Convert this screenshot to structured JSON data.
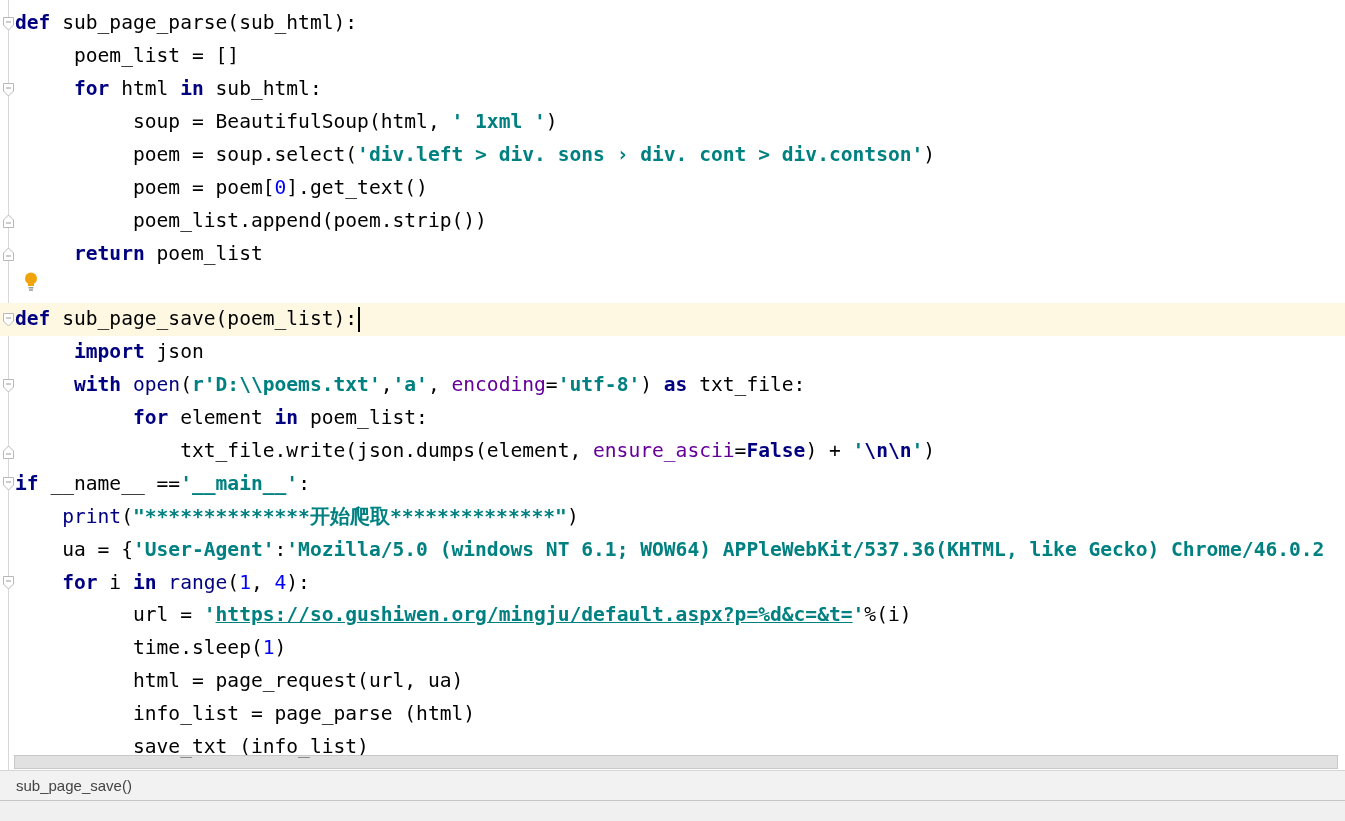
{
  "editor": {
    "lines": [
      {
        "fold_start": true,
        "fold_end": false,
        "current": false,
        "hint": false,
        "tokens": [
          {
            "kind": "kw",
            "text": "def"
          },
          {
            "kind": "plain",
            "text": " sub_page_parse(sub_html):"
          }
        ]
      },
      {
        "fold_start": false,
        "fold_end": false,
        "current": false,
        "hint": false,
        "tokens": [
          {
            "kind": "plain",
            "text": "     poem_list = []"
          }
        ]
      },
      {
        "fold_start": true,
        "fold_end": false,
        "current": false,
        "hint": false,
        "tokens": [
          {
            "kind": "kw",
            "text": "     for"
          },
          {
            "kind": "plain",
            "text": " html "
          },
          {
            "kind": "kw",
            "text": "in"
          },
          {
            "kind": "plain",
            "text": " sub_html:"
          }
        ]
      },
      {
        "fold_start": false,
        "fold_end": false,
        "current": false,
        "hint": false,
        "tokens": [
          {
            "kind": "plain",
            "text": "          soup = BeautifulSoup(html, "
          },
          {
            "kind": "str",
            "text": "' 1xml '"
          },
          {
            "kind": "plain",
            "text": ")"
          }
        ]
      },
      {
        "fold_start": false,
        "fold_end": false,
        "current": false,
        "hint": false,
        "tokens": [
          {
            "kind": "plain",
            "text": "          poem = soup.select("
          },
          {
            "kind": "str",
            "text": "'div.left > div. sons › div. cont > div.contson'"
          },
          {
            "kind": "plain",
            "text": ")"
          }
        ]
      },
      {
        "fold_start": false,
        "fold_end": false,
        "current": false,
        "hint": false,
        "tokens": [
          {
            "kind": "plain",
            "text": "          poem = poem["
          },
          {
            "kind": "num",
            "text": "0"
          },
          {
            "kind": "plain",
            "text": "].get_text()"
          }
        ]
      },
      {
        "fold_start": false,
        "fold_end": true,
        "current": false,
        "hint": false,
        "tokens": [
          {
            "kind": "plain",
            "text": "          poem_list.append(poem.strip())"
          }
        ]
      },
      {
        "fold_start": false,
        "fold_end": true,
        "current": false,
        "hint": false,
        "tokens": [
          {
            "kind": "kw",
            "text": "     return"
          },
          {
            "kind": "plain",
            "text": " poem_list"
          }
        ]
      },
      {
        "fold_start": false,
        "fold_end": false,
        "current": false,
        "hint": true
      },
      {
        "fold_start": true,
        "fold_end": false,
        "current": true,
        "hint": false,
        "tokens": [
          {
            "kind": "kw",
            "text": "def"
          },
          {
            "kind": "plain",
            "text": " sub_page_save(poem_list):"
          }
        ]
      },
      {
        "fold_start": false,
        "fold_end": false,
        "current": false,
        "hint": false,
        "tokens": [
          {
            "kind": "kw",
            "text": "     import"
          },
          {
            "kind": "plain",
            "text": " json"
          }
        ]
      },
      {
        "fold_start": true,
        "fold_end": false,
        "current": false,
        "hint": false,
        "tokens": [
          {
            "kind": "kw",
            "text": "     with"
          },
          {
            "kind": "builtin",
            "text": " open"
          },
          {
            "kind": "plain",
            "text": "("
          },
          {
            "kind": "str",
            "text": "r'D:\\\\poems.txt'"
          },
          {
            "kind": "plain",
            "text": ","
          },
          {
            "kind": "str",
            "text": "'a'"
          },
          {
            "kind": "plain",
            "text": ", "
          },
          {
            "kind": "kwarg",
            "text": "encoding"
          },
          {
            "kind": "plain",
            "text": "="
          },
          {
            "kind": "str",
            "text": "'utf-8'"
          },
          {
            "kind": "plain",
            "text": ") "
          },
          {
            "kind": "kw",
            "text": "as"
          },
          {
            "kind": "plain",
            "text": " txt_file:"
          }
        ]
      },
      {
        "fold_start": false,
        "fold_end": false,
        "current": false,
        "hint": false,
        "tokens": [
          {
            "kind": "kw",
            "text": "          for"
          },
          {
            "kind": "plain",
            "text": " element "
          },
          {
            "kind": "kw",
            "text": "in"
          },
          {
            "kind": "plain",
            "text": " poem_list:"
          }
        ]
      },
      {
        "fold_start": false,
        "fold_end": true,
        "current": false,
        "hint": false,
        "tokens": [
          {
            "kind": "plain",
            "text": "              txt_file.write(json.dumps(element, "
          },
          {
            "kind": "kwarg",
            "text": "ensure_ascii"
          },
          {
            "kind": "plain",
            "text": "="
          },
          {
            "kind": "kw",
            "text": "False"
          },
          {
            "kind": "plain",
            "text": ") + "
          },
          {
            "kind": "str",
            "text": "'"
          },
          {
            "kind": "esc",
            "text": "\\n\\n"
          },
          {
            "kind": "str",
            "text": "'"
          },
          {
            "kind": "plain",
            "text": ")"
          }
        ]
      },
      {
        "fold_start": true,
        "fold_end": false,
        "current": false,
        "hint": false,
        "tokens": [
          {
            "kind": "kw",
            "text": "if"
          },
          {
            "kind": "plain",
            "text": " __name__ =="
          },
          {
            "kind": "str",
            "text": "'__main__'"
          },
          {
            "kind": "plain",
            "text": ":"
          }
        ]
      },
      {
        "fold_start": false,
        "fold_end": false,
        "current": false,
        "hint": false,
        "tokens": [
          {
            "kind": "builtin",
            "text": "    print"
          },
          {
            "kind": "plain",
            "text": "("
          },
          {
            "kind": "str",
            "text": "\"**************开始爬取**************\""
          },
          {
            "kind": "plain",
            "text": ")"
          }
        ]
      },
      {
        "fold_start": false,
        "fold_end": false,
        "current": false,
        "hint": false,
        "tokens": [
          {
            "kind": "plain",
            "text": "    ua = {"
          },
          {
            "kind": "str",
            "text": "'User-Agent'"
          },
          {
            "kind": "plain",
            "text": ":"
          },
          {
            "kind": "str",
            "text": "'Mozilla/5.0 (windows NT 6.1; WOW64) APPleWebKit/537.36(KHTML, like Gecko) Chrome/46.0.2"
          }
        ]
      },
      {
        "fold_start": true,
        "fold_end": false,
        "current": false,
        "hint": false,
        "tokens": [
          {
            "kind": "kw",
            "text": "    for"
          },
          {
            "kind": "plain",
            "text": " i "
          },
          {
            "kind": "kw",
            "text": "in"
          },
          {
            "kind": "builtin",
            "text": " range"
          },
          {
            "kind": "plain",
            "text": "("
          },
          {
            "kind": "num",
            "text": "1"
          },
          {
            "kind": "plain",
            "text": ", "
          },
          {
            "kind": "num",
            "text": "4"
          },
          {
            "kind": "plain",
            "text": "):"
          }
        ]
      },
      {
        "fold_start": false,
        "fold_end": false,
        "current": false,
        "hint": false,
        "tokens": [
          {
            "kind": "plain",
            "text": "          url = "
          },
          {
            "kind": "str",
            "text": "'"
          },
          {
            "kind": "url",
            "text": "https://so.gushiwen.org/mingju/default.aspx?p=%d&c=&t="
          },
          {
            "kind": "str",
            "text": "'"
          },
          {
            "kind": "plain",
            "text": "%(i)"
          }
        ]
      },
      {
        "fold_start": false,
        "fold_end": false,
        "current": false,
        "hint": false,
        "tokens": [
          {
            "kind": "plain",
            "text": "          time.sleep("
          },
          {
            "kind": "num",
            "text": "1"
          },
          {
            "kind": "plain",
            "text": ")"
          }
        ]
      },
      {
        "fold_start": false,
        "fold_end": false,
        "current": false,
        "hint": false,
        "tokens": [
          {
            "kind": "plain",
            "text": "          html = page_request(url, ua)"
          }
        ]
      },
      {
        "fold_start": false,
        "fold_end": false,
        "current": false,
        "hint": false,
        "tokens": [
          {
            "kind": "plain",
            "text": "          info_list = page_parse (html)"
          }
        ]
      },
      {
        "fold_start": false,
        "fold_end": false,
        "current": false,
        "hint": false,
        "tokens": [
          {
            "kind": "plain",
            "text": "          save_txt (info_list)"
          }
        ]
      }
    ]
  },
  "breadcrumb": "sub_page_save()"
}
